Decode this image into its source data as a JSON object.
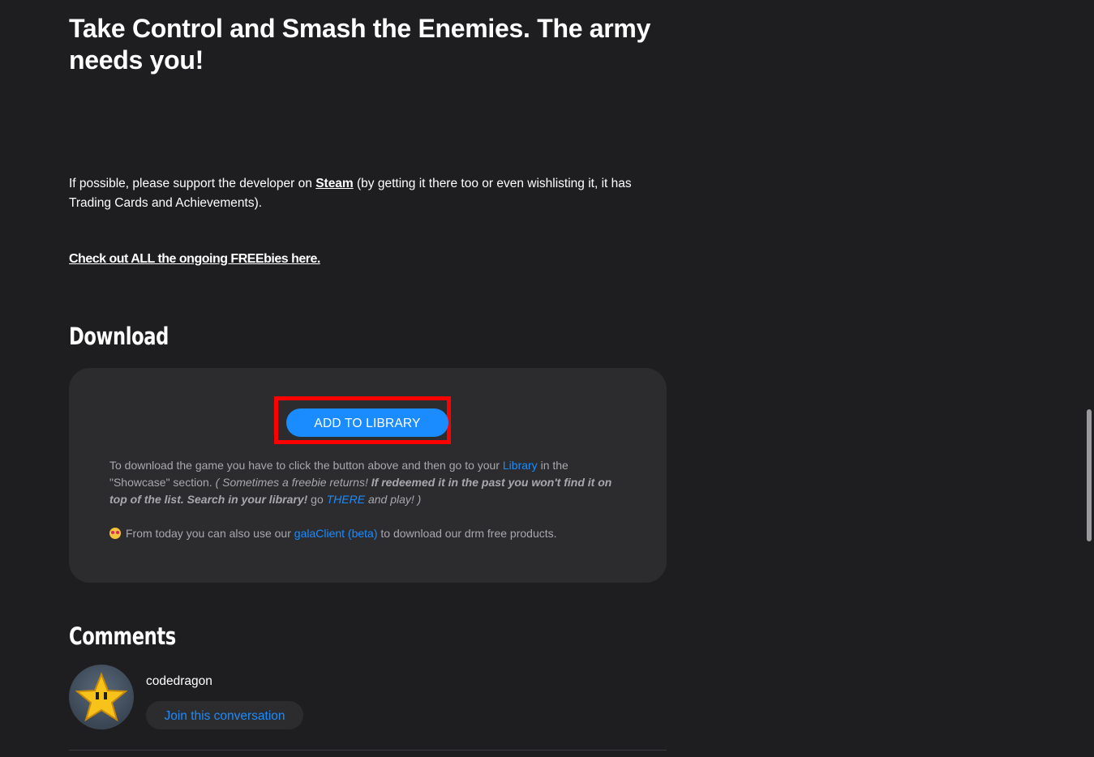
{
  "article": {
    "headline": "Take Control and Smash the Enemies. The army needs you!",
    "support_before": "If possible, please support the developer on ",
    "support_link": "Steam",
    "support_after": " (by getting it there too or even wishlisting it, it has Trading Cards and Achievements).",
    "freebies_link": "Check out ALL the ongoing FREEbies here."
  },
  "download": {
    "title": "Download",
    "button_label": "ADD TO LIBRARY",
    "instr_part1": "To download the game you have to click the button above and then go to your ",
    "instr_library_link": "Library",
    "instr_part2": " in the \"Showcase\" section. ",
    "instr_italic1": "( Sometimes a freebie returns! ",
    "instr_bold_italic": "If redeemed it in the past you won't find it on top of the list. Search in your library!",
    "instr_go": " go ",
    "instr_there_link": "THERE",
    "instr_italic2": " and play! )",
    "client_before": "From today you can also use our ",
    "client_link": "galaClient (beta)",
    "client_after": " to download our drm free products.",
    "emoji_icon": "star-struck-emoji"
  },
  "comments": {
    "title": "Comments",
    "username": "codedragon",
    "join_label": "Join this conversation",
    "avatar_icon": "star-icon"
  },
  "colors": {
    "background": "#1e1e20",
    "panel": "#2c2c2f",
    "accent": "#1a8cff",
    "highlight": "#ff0000"
  }
}
